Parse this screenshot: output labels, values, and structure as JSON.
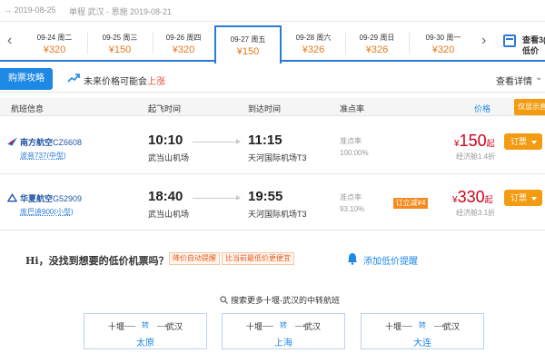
{
  "topbar": {
    "left_date": "→ 2019-08-25",
    "route_label": "单程 武汉 - 恩施 2019-08-21"
  },
  "date_strip": {
    "prev_icon": "chevron-left-icon",
    "cells": [
      {
        "date": "09-24 周二",
        "price": "¥320",
        "selected": false
      },
      {
        "date": "09-25 周三",
        "price": "¥150",
        "selected": false
      },
      {
        "date": "09-26 周四",
        "price": "¥320",
        "selected": false
      },
      {
        "date": "09-27 周五",
        "price": "¥150",
        "selected": true
      },
      {
        "date": "09-28 周六",
        "price": "¥326",
        "selected": false
      },
      {
        "date": "09-29 周日",
        "price": "¥326",
        "selected": false
      },
      {
        "date": "09-30 周一",
        "price": "¥320",
        "selected": false
      }
    ],
    "next_icon": "chevron-right-icon",
    "calendar_line1": "查看3(",
    "calendar_line2": "低价"
  },
  "info_bar": {
    "guide_label": "购票攻略",
    "trend_prefix": "未来价格可能会",
    "trend_highlight": "上涨",
    "view_detail": "查看详情"
  },
  "table_header": {
    "flight_info": "航班信息",
    "depart_time": "起飞时间",
    "arrive_time": "到达时间",
    "on_time": "准点率",
    "price": "价格",
    "low_price_btn": "仅显示直"
  },
  "flights": [
    {
      "airline": "南方航空",
      "flight_no": "CZ6608",
      "aircraft": "波音737(中型)",
      "depart_time": "10:10",
      "depart_airport": "武当山机场",
      "arrive_time": "11:15",
      "arrive_airport": "天河国际机场T3",
      "on_time_label": "准点率",
      "on_time_value": "100.00%",
      "promo": "",
      "price_symbol": "¥",
      "price": "150",
      "price_suffix": "起",
      "discount": "经济舱1.4折",
      "book_label": "订票"
    },
    {
      "airline": "华夏航空",
      "flight_no": "G52909",
      "aircraft": "庞巴迪900(小型)",
      "depart_time": "18:40",
      "depart_airport": "武当山机场",
      "arrive_time": "19:55",
      "arrive_airport": "天河国际机场T3",
      "on_time_label": "准点率",
      "on_time_value": "93.10%",
      "promo": "订立减¥4",
      "price_symbol": "¥",
      "price": "330",
      "price_suffix": "起",
      "discount": "经济舱3.1折",
      "book_label": "订票"
    }
  ],
  "low_price": {
    "title": "Hi，没找到想要的低价机票吗？",
    "tag1": "降价自动提醒",
    "tag2": "比当前最低价更便宜",
    "alert_link": "添加低价提醒"
  },
  "transfer": {
    "search_more": "搜索更多十堰-武汉的中转航班",
    "boxes": [
      {
        "from": "十堰",
        "via_label": "转",
        "to": "武汉",
        "via": "太原"
      },
      {
        "from": "十堰",
        "via_label": "转",
        "to": "武汉",
        "via": "上海"
      },
      {
        "from": "十堰",
        "via_label": "转",
        "to": "武汉",
        "via": "大连"
      }
    ]
  },
  "colors": {
    "accent": "#1e88e5",
    "price_red": "#d0021b",
    "price_orange": "#e27a1c",
    "book_orange": "#f39c12"
  }
}
